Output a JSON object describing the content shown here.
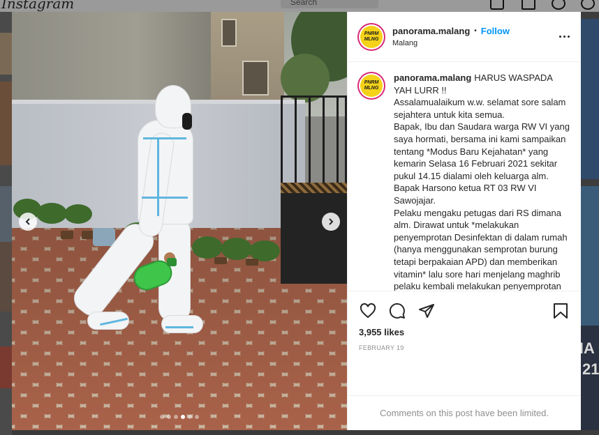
{
  "background": {
    "logo_text": "Instagram",
    "search_placeholder": "Search",
    "nav_icons": [
      "home-icon",
      "direct-icon",
      "explore-icon",
      "heart-icon"
    ],
    "right_text_1": "HA",
    "right_text_2": "21"
  },
  "media": {
    "carousel_count": 6,
    "active_index": 3,
    "prev_icon": "chevron-left-icon",
    "next_icon": "chevron-right-icon"
  },
  "header": {
    "username": "panorama.malang",
    "separator": "•",
    "follow_label": "Follow",
    "location": "Malang",
    "avatar_line1": "PNRM",
    "avatar_line2": "MLNG",
    "more_icon": "more-options-icon"
  },
  "caption": {
    "username": "panorama.malang",
    "text": "HARUS WASPADA YAH LURR !!\nAssalamualaikum w.w. selamat sore salam sejahtera untuk kita semua.\nBapak, Ibu dan Saudara warga RW VI yang saya hormati, bersama ini kami sampaikan tentang *Modus Baru Kejahatan* yang kemarin Selasa 16 Februari 2021 sekitar pukul 14.15 dialami oleh keluarga alm. Bapak Harsono ketua RT 03 RW VI Sawojajar.\nPelaku mengaku petugas dari RS dimana alm. Dirawat untuk *melakukan penyemprotan Desinfektan di dalam rumah (hanya menggunakan semprotan burung tetapi berpakaian APD) dan memberikan vitamin* lalu sore hari menjelang maghrib pelaku kembali melakukan penyemprotan kedua"
  },
  "actions": {
    "like_icon": "heart-icon",
    "comment_icon": "comment-icon",
    "share_icon": "share-icon",
    "save_icon": "bookmark-icon",
    "likes_text": "3,955 likes",
    "date_text": "FEBRUARY 19"
  },
  "comments": {
    "limited_text": "Comments on this post have been limited."
  },
  "colors": {
    "follow": "#0095f6",
    "avatar_ring": "#d62976",
    "avatar_fill": "#f5d21a"
  }
}
